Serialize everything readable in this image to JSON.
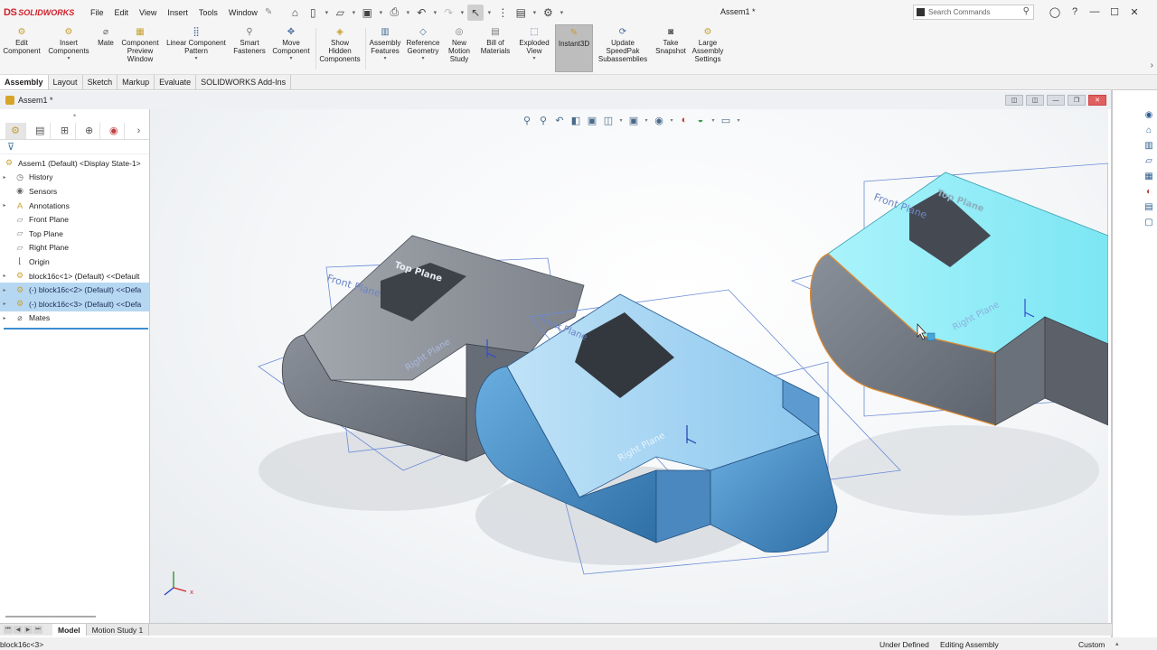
{
  "app": {
    "logo_prefix": "DS",
    "logo_text": "SOLIDWORKS",
    "document_title": "Assem1 *"
  },
  "menu": [
    "File",
    "Edit",
    "View",
    "Insert",
    "Tools",
    "Window"
  ],
  "search": {
    "placeholder": "Search Commands"
  },
  "commands": [
    {
      "label": "Edit\nComponent"
    },
    {
      "label": "Insert\nComponents"
    },
    {
      "label": "Mate"
    },
    {
      "label": "Component\nPreview\nWindow"
    },
    {
      "label": "Linear Component\nPattern"
    },
    {
      "label": "Smart\nFasteners"
    },
    {
      "label": "Move\nComponent"
    },
    {
      "label": "Show\nHidden\nComponents"
    },
    {
      "label": "Assembly\nFeatures"
    },
    {
      "label": "Reference\nGeometry"
    },
    {
      "label": "New\nMotion\nStudy"
    },
    {
      "label": "Bill of\nMaterials"
    },
    {
      "label": "Exploded\nView"
    },
    {
      "label": "Instant3D"
    },
    {
      "label": "Update\nSpeedPak\nSubassemblies"
    },
    {
      "label": "Take\nSnapshot"
    },
    {
      "label": "Large\nAssembly\nSettings"
    }
  ],
  "tabs": [
    "Assembly",
    "Layout",
    "Sketch",
    "Markup",
    "Evaluate",
    "SOLIDWORKS Add-Ins"
  ],
  "doc_tab": {
    "label": "Assem1 *"
  },
  "tree": [
    {
      "label": "Assem1 (Default) <Display State-1>"
    },
    {
      "label": "History"
    },
    {
      "label": "Sensors"
    },
    {
      "label": "Annotations"
    },
    {
      "label": "Front Plane"
    },
    {
      "label": "Top Plane"
    },
    {
      "label": "Right Plane"
    },
    {
      "label": "Origin"
    },
    {
      "label": "block16c<1> (Default) <<Default"
    },
    {
      "label": "(-) block16c<2> (Default) <<Defa"
    },
    {
      "label": "(-) block16c<3> (Default) <<Defa"
    },
    {
      "label": "Mates"
    }
  ],
  "plane_labels": {
    "front": "Front Plane",
    "top": "Top Plane",
    "right": "Right Plane"
  },
  "bottom_tabs": [
    "Model",
    "Motion Study 1"
  ],
  "status": {
    "left": "block16c<3>",
    "under_defined": "Under Defined",
    "editing": "Editing Assembly",
    "units": "Custom"
  },
  "colors": {
    "accent_blue": "#3d8ed0",
    "selected_cyan": "#7fe8f5",
    "part_grey": "#6f7682",
    "selected_blue": "#5aa3d8",
    "logo_red": "#d0202a"
  }
}
